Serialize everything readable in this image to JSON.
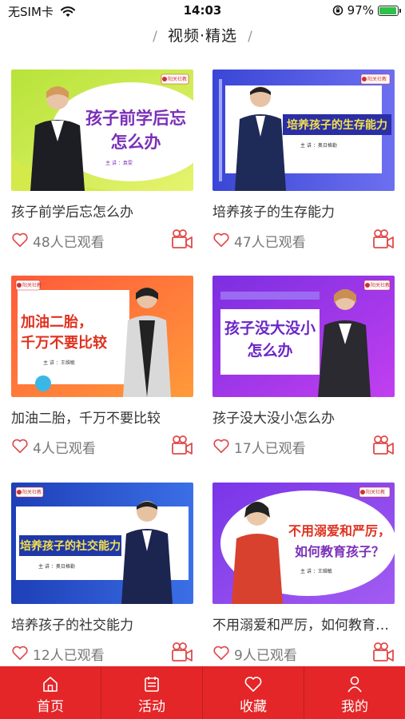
{
  "status_bar": {
    "carrier": "无SIM卡",
    "time": "14:03",
    "battery": "97%",
    "battery_level": 0.97
  },
  "header": {
    "title": "视频·精选",
    "left_slash": "/",
    "right_slash": "/"
  },
  "videos": [
    {
      "thumb_text_1": "孩子前学后忘",
      "thumb_text_2": "怎么办",
      "thumb_brand": "阳关社教",
      "thumb_speaker": "主 讲 ：袁雯",
      "title": "孩子前学后忘怎么办",
      "views": "48人已观看"
    },
    {
      "thumb_text_1": "培养孩子的生存能力",
      "thumb_brand": "阳关社教",
      "thumb_speaker": "主 讲 ：奥日格勒",
      "title": "培养孩子的生存能力",
      "views": "47人已观看"
    },
    {
      "thumb_text_1": "加油二胎，",
      "thumb_text_2": "千万不要比较",
      "thumb_brand": "阳关社教",
      "thumb_speaker": "主 讲 ：王维敏",
      "title": "加油二胎，千万不要比较",
      "views": "4人已观看"
    },
    {
      "thumb_text_1": "孩子没大没小",
      "thumb_text_2": "怎么办",
      "thumb_brand": "阳关社教",
      "thumb_speaker": "主 讲 ：袁雯",
      "title": "孩子没大没小怎么办",
      "views": "17人已观看"
    },
    {
      "thumb_text_1": "培养孩子的社交能力",
      "thumb_brand": "阳关社教",
      "thumb_speaker": "主 讲 ：奥日格勒",
      "title": "培养孩子的社交能力",
      "views": "12人已观看"
    },
    {
      "thumb_text_1": "不用溺爱和严厉，",
      "thumb_text_2": "如何教育孩子？",
      "thumb_brand": "阳关社教",
      "thumb_speaker": "主 讲 ：王维敏",
      "title": "不用溺爱和严厉，如何教育孩子？",
      "views": "9人已观看"
    }
  ],
  "tabs": [
    {
      "label": "首页",
      "icon": "home-icon"
    },
    {
      "label": "活动",
      "icon": "calendar-icon"
    },
    {
      "label": "收藏",
      "icon": "heart-icon"
    },
    {
      "label": "我的",
      "icon": "user-icon"
    }
  ],
  "colors": {
    "accent": "#e42628",
    "icon_red": "#e04a4a",
    "text": "#333333",
    "muted": "#777777"
  }
}
